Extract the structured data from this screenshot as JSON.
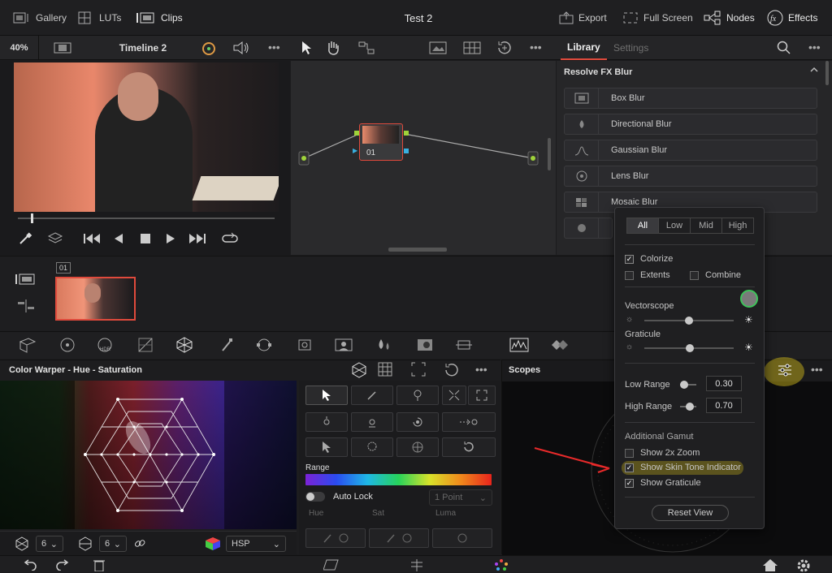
{
  "topbar": {
    "gallery": "Gallery",
    "luts": "LUTs",
    "clips": "Clips",
    "title": "Test 2",
    "export": "Export",
    "fullscreen": "Full Screen",
    "nodes": "Nodes",
    "effects": "Effects"
  },
  "viewer": {
    "zoom": "40%",
    "timeline": "Timeline 2"
  },
  "node": {
    "label": "01"
  },
  "library": {
    "tab_library": "Library",
    "tab_settings": "Settings",
    "section": "Resolve FX Blur",
    "items": [
      "Box Blur",
      "Directional Blur",
      "Gaussian Blur",
      "Lens Blur",
      "Mosaic Blur"
    ]
  },
  "clips": {
    "clip_number": "01"
  },
  "warper": {
    "title": "Color Warper - Hue - Saturation",
    "range_label": "Range",
    "auto_lock": "Auto Lock",
    "point_mode": "1 Point",
    "hue_label": "Hue",
    "sat_label": "Sat",
    "luma_label": "Luma",
    "grid_a": "6",
    "grid_b": "6",
    "colorspace": "HSP"
  },
  "scopes": {
    "title": "Scopes"
  },
  "popup": {
    "tabs": [
      "All",
      "Low",
      "Mid",
      "High"
    ],
    "colorize": "Colorize",
    "extents": "Extents",
    "combine": "Combine",
    "vectorscope": "Vectorscope",
    "graticule": "Graticule",
    "low_range_label": "Low Range",
    "low_range_value": "0.30",
    "high_range_label": "High Range",
    "high_range_value": "0.70",
    "additional_gamut": "Additional Gamut",
    "show_2x_zoom": "Show 2x Zoom",
    "show_skin_tone": "Show Skin Tone Indicator",
    "show_graticule": "Show Graticule",
    "reset_view": "Reset View"
  },
  "colors": {
    "accent_red": "#e04a3c",
    "node_green": "#9fd33a",
    "highlight_yellow": "#d9c21a"
  }
}
